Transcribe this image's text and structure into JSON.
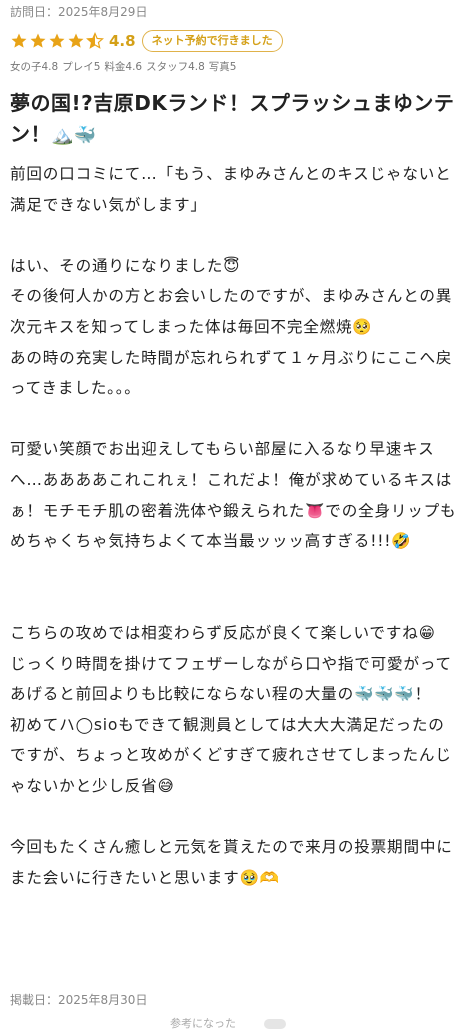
{
  "header": {
    "visit_label": "訪問日：2025年8月29日",
    "rating": {
      "stars": 4.8,
      "value_text": "4.8"
    },
    "net_badge": "ネット予約で行きました",
    "sub_ratings": [
      "女の子4.8",
      "プレイ5",
      "料金4.6",
      "スタッフ4.8",
      "写真5"
    ],
    "star_color": "#e8a317"
  },
  "review": {
    "title": "夢の国!?吉原DKランド！スプラッシュまゆンテン！",
    "title_icons": "🏔️🐳",
    "paragraphs": [
      "前回の口コミにて…「もう、まゆみさんとのキスじゃないと満足できない気がします」",
      "はい、その通りになりました😇",
      "その後何人かの方とお会いしたのですが、まゆみさんとの異次元キスを知ってしまった体は毎回不完全燃焼🥺",
      "あの時の充実した時間が忘れられずて１ヶ月ぶりにここへ戻ってきました。。。",
      "可愛い笑顔でお出迎えしてもらい部屋に入るなり早速キスへ…ああああこれこれぇ！これだよ！俺が求めているキスはぁ！モチモチ肌の密着洗体や鍛えられた👅での全身リップもめちゃくちゃ気持ちよくて本当最ッッッ高すぎる!!!🤣",
      "こちらの攻めでは相変わらず反応が良くて楽しいですね😁",
      "じっくり時間を掛けてフェザーしながら口や指で可愛がってあげると前回よりも比較にならない程の大量の🐳🐳🐳！",
      "初めてハ◯sioもできて観測員としては大大大満足だったのですが、ちょっと攻めがくどすぎて疲れさせてしまったんじゃないかと少し反省😅",
      "今回もたくさん癒しと元気を貰えたので来月の投票期間中にまた会いに行きたいと思います🥹🫶"
    ]
  },
  "footer": {
    "posted_label": "掲載日：2025年8月30日",
    "peek_text": "参考になった"
  }
}
